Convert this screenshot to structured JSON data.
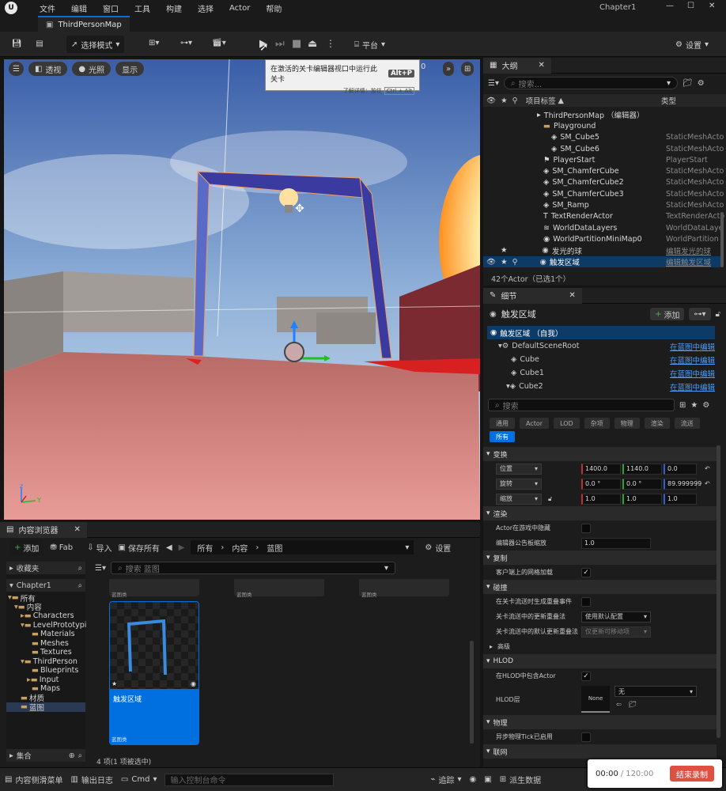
{
  "window": {
    "title": "Chapter1",
    "menu": [
      "文件",
      "编辑",
      "窗口",
      "工具",
      "构建",
      "选择",
      "Actor",
      "帮助"
    ],
    "tab": "ThirdPersonMap"
  },
  "toolbar": {
    "mode": "选择模式",
    "platform": "平台",
    "settings": "设置"
  },
  "viewport": {
    "perspective": "透视",
    "lit": "光照",
    "show": "显示"
  },
  "tooltip": {
    "text": "在激活的关卡编辑器视口中运行此关卡",
    "key": "Alt+P",
    "more": "了解详情：按住",
    "more_key": "Ctrl + Alt"
  },
  "outliner": {
    "tab": "大纲",
    "search_placeholder": "搜索...",
    "col_label": "项目标签",
    "col_type": "类型",
    "rows": [
      {
        "label": "ThirdPersonMap （编辑器）",
        "type": ""
      },
      {
        "label": "Playground",
        "type": ""
      },
      {
        "label": "SM_Cube5",
        "type": "StaticMeshActo"
      },
      {
        "label": "SM_Cube6",
        "type": "StaticMeshActo"
      },
      {
        "label": "PlayerStart",
        "type": "PlayerStart"
      },
      {
        "label": "SM_ChamferCube",
        "type": "StaticMeshActo"
      },
      {
        "label": "SM_ChamferCube2",
        "type": "StaticMeshActo"
      },
      {
        "label": "SM_ChamferCube3",
        "type": "StaticMeshActo"
      },
      {
        "label": "SM_Ramp",
        "type": "StaticMeshActo"
      },
      {
        "label": "TextRenderActor",
        "type": "TextRenderActo"
      },
      {
        "label": "WorldDataLayers",
        "type": "WorldDataLaye"
      },
      {
        "label": "WorldPartitionMiniMap0",
        "type": "WorldPartition"
      },
      {
        "label": "发光的球",
        "type": "编辑发光的球"
      },
      {
        "label": "触发区域",
        "type": "编辑触发区域"
      }
    ],
    "status": "42个Actor（已选1个）"
  },
  "details": {
    "tab": "细节",
    "actor": "触发区域",
    "add": "添加",
    "self": "触发区域 （自我）",
    "components": [
      {
        "label": "DefaultSceneRoot",
        "link": "在蓝图中编辑"
      },
      {
        "label": "Cube",
        "link": "在蓝图中编辑"
      },
      {
        "label": "Cube1",
        "link": "在蓝图中编辑"
      },
      {
        "label": "Cube2",
        "link": "在蓝图中编辑"
      }
    ],
    "search_placeholder": "搜索",
    "categories": [
      "通用",
      "Actor",
      "LOD",
      "杂项",
      "物理",
      "渲染",
      "流送"
    ],
    "all": "所有",
    "transform": {
      "title": "变换",
      "location": "位置",
      "rotation": "旋转",
      "scale": "缩放",
      "loc": [
        "1400.0",
        "1140.0",
        "0.0"
      ],
      "rot": [
        "0.0 °",
        "0.0 °",
        "89.999999"
      ],
      "scl": [
        "1.0",
        "1.0",
        "1.0"
      ]
    },
    "rendering": {
      "title": "渲染",
      "hidden": "Actor在游戏中隐藏",
      "billboard": "编辑器公告板缩放",
      "billboard_val": "1.0"
    },
    "replication": {
      "title": "复制",
      "net_load": "客户端上的网格加载"
    },
    "collision": {
      "title": "碰撞",
      "gen_overlap": "在关卡流送时生成重叠事件",
      "update_method": "关卡流送中的更新重叠法",
      "update_val": "使用默认配置",
      "default_method": "关卡流送中的默认更新重叠法",
      "default_val": "仅更新可移动项"
    },
    "advanced": "高级",
    "hlod": {
      "title": "HLOD",
      "include": "在HLOD中包含Actor",
      "layer": "HLOD层",
      "none_thumb": "None",
      "none_val": "无"
    },
    "physics": {
      "title": "物理",
      "async": "异步物理Tick已启用"
    },
    "network": "联网"
  },
  "content_browser": {
    "tab": "内容浏览器",
    "add": "添加",
    "fab": "Fab",
    "import": "导入",
    "save_all": "保存所有",
    "path": [
      "所有",
      "内容",
      "蓝图"
    ],
    "settings": "设置",
    "favorites": "收藏夹",
    "project": "Chapter1",
    "search_placeholder": "搜索 蓝图",
    "tree": [
      "所有",
      "内容",
      "Characters",
      "LevelPrototypi",
      "Materials",
      "Meshes",
      "Textures",
      "ThirdPerson",
      "Blueprints",
      "Input",
      "Maps",
      "材质",
      "蓝图"
    ],
    "asset": {
      "name": "触发区域",
      "type": "蓝图类"
    },
    "other_asset_type": "蓝图类",
    "count": "4 项(1 项被选中)",
    "collections": "集合"
  },
  "statusbar": {
    "drawer": "内容侧滑菜单",
    "output": "输出日志",
    "cmd": "Cmd",
    "cmd_placeholder": "输入控制台命令",
    "trace": "追踪",
    "derived": "派生数据",
    "source": "源码管理"
  },
  "recorder": {
    "time": "00:00",
    "total": "120:00",
    "stop": "结束录制"
  },
  "colors": {
    "accent": "#0070e0",
    "link": "#4a9eff",
    "selected": "#0e3a66",
    "stop": "#e05040"
  }
}
